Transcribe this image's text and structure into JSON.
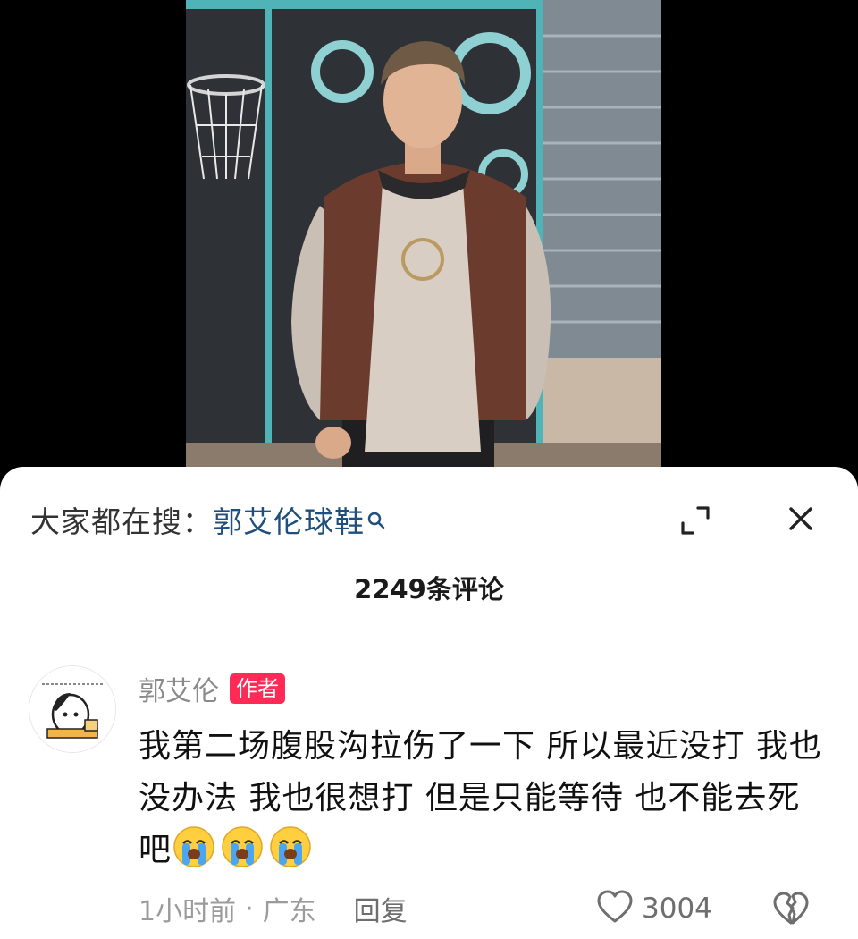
{
  "search_suggest": {
    "prefix": "大家都在搜：",
    "term": "郭艾伦球鞋"
  },
  "comments_header": {
    "count_label": "2249条评论"
  },
  "comment": {
    "author": "郭艾伦",
    "badge": "作者",
    "text": "我第二场腹股沟拉伤了一下 所以最近没打 我也没办法 我也很想打 但是只能等待 也不能去死吧",
    "emoji_name": "loudly-crying-face",
    "emoji_count": 3,
    "time": "1小时前",
    "separator": "·",
    "location": "广东",
    "reply_label": "回复",
    "likes": "3004"
  },
  "icons": {
    "search": "search-icon",
    "expand": "expand-icon",
    "close": "close-icon",
    "like": "heart-outline-icon",
    "dislike": "broken-heart-icon"
  },
  "colors": {
    "search_term": "#1f4f7c",
    "badge_bg": "#ff2a55",
    "sheet_bg": "#ffffff",
    "backdrop": "#000000"
  }
}
